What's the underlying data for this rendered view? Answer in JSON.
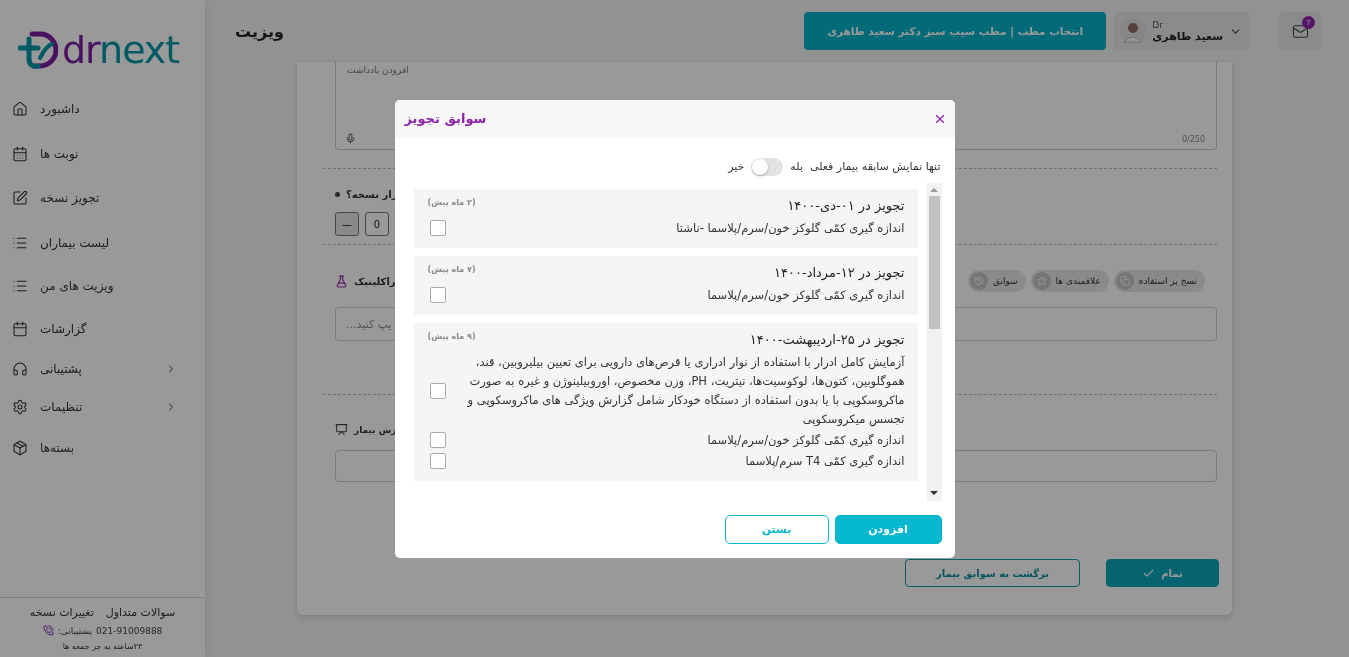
{
  "sidebar": {
    "logo": {
      "text": "drnext"
    },
    "items": [
      {
        "label": "داشبورد",
        "has_submenu": false
      },
      {
        "label": "نوبت ها",
        "has_submenu": false
      },
      {
        "label": "تجویز نسخه",
        "has_submenu": false
      },
      {
        "label": "لیست بیماران",
        "has_submenu": false
      },
      {
        "label": "ویزیت های من",
        "has_submenu": false
      },
      {
        "label": "گزارشات",
        "has_submenu": false
      },
      {
        "label": "پشتیبانی",
        "has_submenu": true
      },
      {
        "label": "تنظیمات",
        "has_submenu": true
      },
      {
        "label": "بسته‌ها",
        "has_submenu": false
      }
    ],
    "footer": {
      "links": [
        "سوالات متداول",
        "تغییرات نسخه"
      ],
      "support_label": "پشتیبانی:",
      "phone": "021-91009888",
      "hours": "۲۴ساعته به جز جمعه ها"
    }
  },
  "header": {
    "title": "ویزیت",
    "clinic_button": "انتخاب مطب | مطب سیب سبز دکتر سعید طاهری",
    "user": {
      "prefix": "Dr",
      "name": "سعید طاهری"
    },
    "messages_badge": "7"
  },
  "visit_form": {
    "note": {
      "placeholder": "افزودن یادداشت",
      "counter": "0/250"
    },
    "repeat": {
      "label": "رار نسخه؟",
      "decrement": "—",
      "value": "0"
    },
    "paraclinic": {
      "label": "راکلینیک",
      "chips": [
        "نسخ پر استفاده",
        "علاقمندی ها",
        "سوابق"
      ],
      "search_placeholder": "یپ کنید..."
    },
    "education": {
      "label": "زش بیمار"
    },
    "actions": [
      {
        "label": "تمام",
        "kind": "primary"
      },
      {
        "label": "برگشت به سوابق بیمار",
        "kind": "secondary"
      }
    ]
  },
  "modal": {
    "title": "سوابق تجویز",
    "filter": {
      "label": "تنها نمایش سابقه بیمار فعلی",
      "yes": "بله",
      "no": "خیر",
      "on": false
    },
    "records": [
      {
        "title": "تجویز در ۰۱-دی-۱۴۰۰",
        "ago": "(۲ ماه پیش)",
        "items": [
          {
            "text": "اندازه گیری کمّی گلوکز خون/سرم/پلاسما -ناشتا",
            "checked": false
          }
        ]
      },
      {
        "title": "تجویز در ۱۲-مرداد-۱۴۰۰",
        "ago": "(۷ ماه پیش)",
        "items": [
          {
            "text": "اندازه گیری کمّی گلوکز خون/سرم/پلاسما",
            "checked": false
          }
        ]
      },
      {
        "title": "تجویز در ۲۵-اردیبهشت-۱۴۰۰",
        "ago": "(۹ ماه پیش)",
        "items": [
          {
            "text": "آزمایش کامل ادرار با استفاده از نوار ادراری یا قرص‌های دارویی برای تعیین بیلیروبین، قند، هموگلوبین، کتون‌ها، لوکوسیت‌ها، نیتریت، PH، وزن مخصوص، اوروبیلینوژن و غیره به صورت ماکروسکوپی با یا بدون استفاده از دستگاه خودکار شامل گزارش ویژگی های ماکروسکوپی و تجسس میکروسکوپی",
            "checked": false
          },
          {
            "text": "اندازه گیری کمّی گلوکز خون/سرم/پلاسما",
            "checked": false
          },
          {
            "text": "اندازه گیری کمّی T4 سرم/پلاسما",
            "checked": false
          }
        ]
      }
    ],
    "buttons": [
      {
        "label": "افزودن",
        "kind": "primary"
      },
      {
        "label": "بستن",
        "kind": "secondary"
      }
    ]
  }
}
